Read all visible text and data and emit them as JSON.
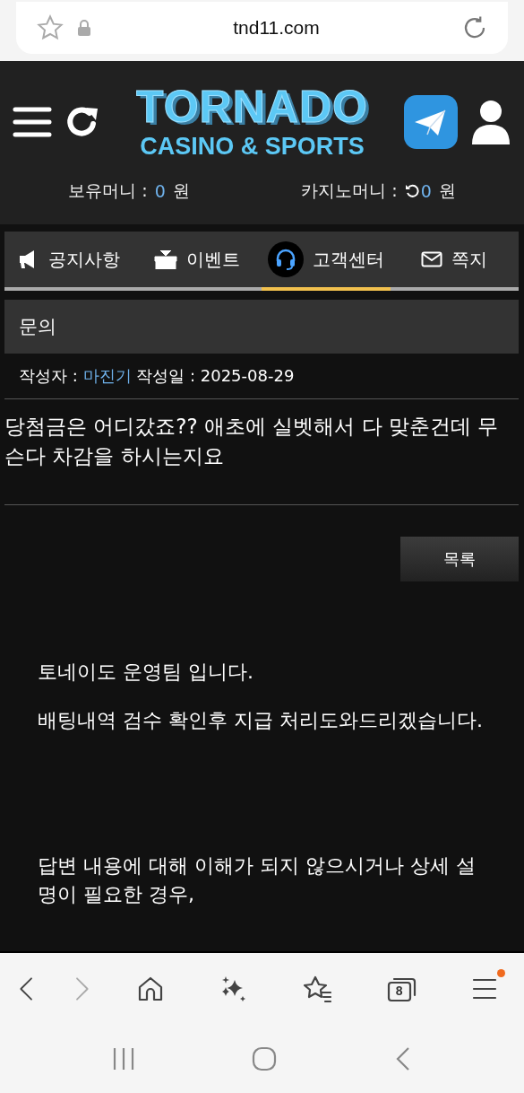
{
  "address_bar": {
    "url": "tnd11.com"
  },
  "header": {
    "logo_title": "TORNADO",
    "logo_subtitle": "CASINO & SPORTS"
  },
  "balances": [
    {
      "label": "보유머니 : ",
      "amount": "0",
      "unit": " 원",
      "refresh": false
    },
    {
      "label": "카지노머니 : ",
      "amount": "0",
      "unit": " 원",
      "refresh": true
    }
  ],
  "tabs": [
    {
      "kind": "megaphone",
      "label": "공지사항",
      "selected": false
    },
    {
      "kind": "gift",
      "label": "이벤트",
      "selected": false
    },
    {
      "kind": "headset",
      "label": "고객센터",
      "selected": true
    },
    {
      "kind": "mail",
      "label": "쪽지",
      "selected": false
    }
  ],
  "board_title": "문의",
  "meta": {
    "author_label": "작성자 : ",
    "author": "마진기",
    "date_label": "작성일 : 2025-08-29"
  },
  "question": "당첨금은 어디갔죠?? 애초에 실벳해서 다 맞춘건데 무슨다 차감을 하시는지요",
  "list_button": "목록",
  "answer": [
    "토네이도 운영팀 입니다.",
    "배팅내역 검수 확인후 지급 처리도와드리겠습니다.",
    "답변 내용에 대해 이해가 되지 않으시거나 상세 설명이 필요한 경우,"
  ],
  "browser_toolbar": {
    "back_disabled": false,
    "forward_disabled": true,
    "tab_count": "8",
    "menu_notification": true
  }
}
